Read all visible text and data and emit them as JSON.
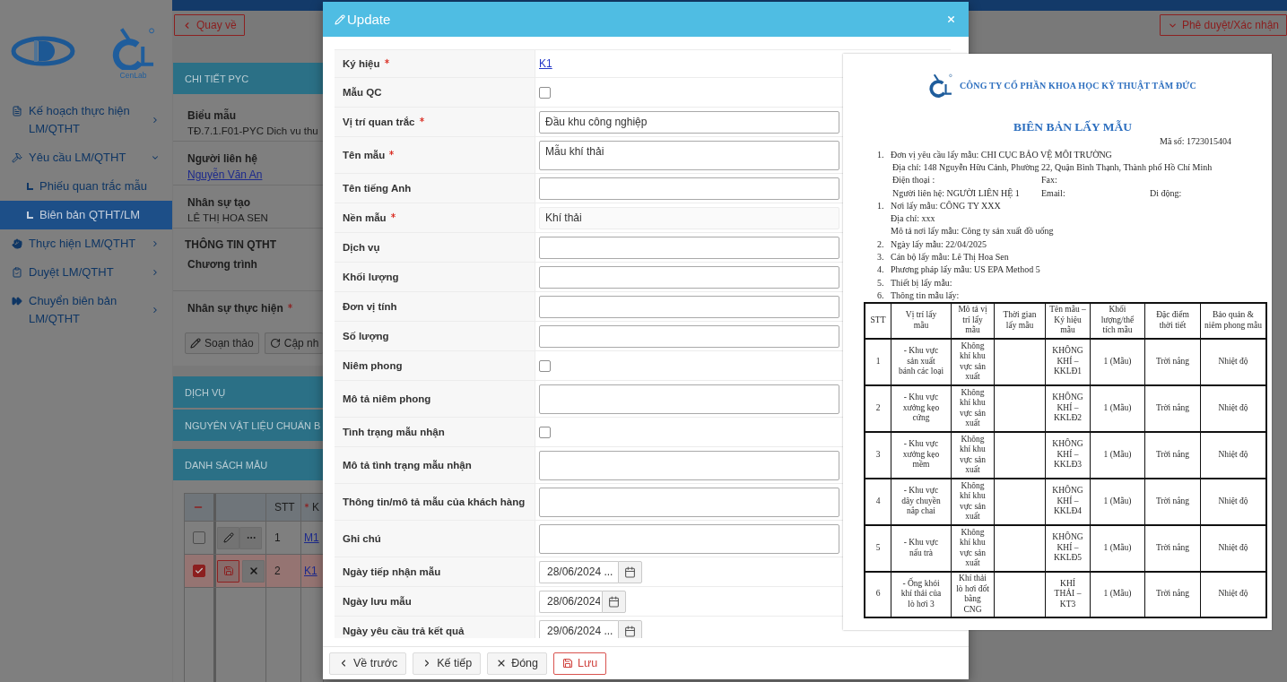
{
  "sidebar": {
    "logo_caption": "CenLab",
    "items": [
      {
        "label": "Kế hoạch thực hiện LM/QTHT",
        "selected": false,
        "expanded": false
      },
      {
        "label": "Yêu cầu LM/QTHT",
        "selected": false,
        "expanded": true,
        "children": [
          {
            "label": "Phiếu quan trắc mẫu",
            "selected": false
          },
          {
            "label": "Biên bản QTHT/LM",
            "selected": true
          }
        ]
      },
      {
        "label": "Thực hiện LM/QTHT",
        "selected": false,
        "expanded": false
      },
      {
        "label": "Duyệt LM/QTHT",
        "selected": false,
        "expanded": false
      },
      {
        "label": "Chuyển biên bản LM/QTHT",
        "selected": false,
        "expanded": false
      }
    ]
  },
  "toolbar": {
    "back_button": "Quay về",
    "approve_button": "Phê duyệt/Xác nhận"
  },
  "detail": {
    "header": "CHI TIẾT PYC",
    "fields": [
      {
        "label": "Biểu mẫu",
        "value": "TĐ.7.1.F01-PYC Dich vu thu",
        "kind": "text"
      },
      {
        "label": "Người liên hệ",
        "value": "Nguyễn Văn An",
        "kind": "link"
      },
      {
        "label": "Nhân sự tạo",
        "value": "LÊ THỊ HOA SEN",
        "kind": "text"
      }
    ],
    "section_title": "THÔNG TIN QTHT",
    "program_label": "Chương trình",
    "staff_label": "Nhân sự thực hiện",
    "staff_required": true,
    "buttons": [
      {
        "label": "Soạn thảo",
        "kind": "edit"
      },
      {
        "label": "Cập nh",
        "kind": "refresh"
      }
    ]
  },
  "sections": [
    "DỊCH VỤ",
    "NGUYÊN VẬT LIỆU CHUẨN B",
    "DANH SÁCH MẪU"
  ],
  "samples_table": {
    "columns": [
      {
        "label": "STT",
        "required": false
      },
      {
        "label": "K",
        "required": true
      }
    ],
    "rows": [
      {
        "checked": false,
        "selected": false,
        "editing": false,
        "stt": "1",
        "code": "M1"
      },
      {
        "checked": true,
        "selected": true,
        "editing": true,
        "stt": "2",
        "code": "K1"
      }
    ]
  },
  "modal": {
    "title": "Update",
    "fields": [
      {
        "kind": "link",
        "label": "Ký hiệu",
        "required": true,
        "value": "K1"
      },
      {
        "kind": "checkbox",
        "label": "Mẫu QC",
        "required": false,
        "checked": false
      },
      {
        "kind": "text",
        "label": "Vị trí quan trắc",
        "required": true,
        "value": "Đầu khu công nghiệp"
      },
      {
        "kind": "textarea",
        "label": "Tên mẫu",
        "required": true,
        "value": "Mẫu khí thải"
      },
      {
        "kind": "text",
        "label": "Tên tiếng Anh",
        "required": false
      },
      {
        "kind": "readonly",
        "label": "Nền mẫu",
        "required": true,
        "value": "Khí thải"
      },
      {
        "kind": "text",
        "label": "Dịch vụ",
        "required": false
      },
      {
        "kind": "text",
        "label": "Khối lượng",
        "required": false
      },
      {
        "kind": "text",
        "label": "Đơn vị tính",
        "required": false
      },
      {
        "kind": "text",
        "label": "Số lượng",
        "required": false
      },
      {
        "kind": "checkbox",
        "label": "Niêm phong",
        "required": false,
        "checked": false
      },
      {
        "kind": "textarea",
        "label": "Mô tả niêm phong",
        "required": false
      },
      {
        "kind": "checkbox",
        "label": "Tình trạng mẫu nhận",
        "required": false,
        "checked": false
      },
      {
        "kind": "textarea",
        "label": "Mô tả tình trạng mẫu nhận",
        "required": false
      },
      {
        "kind": "textarea",
        "label": "Thông tin/mô tả mẫu của khách hàng",
        "required": false
      },
      {
        "kind": "textarea",
        "label": "Ghi chú",
        "required": false
      },
      {
        "kind": "datetime",
        "label": "Ngày tiếp nhận mẫu",
        "required": false,
        "value": "28/06/2024 ..."
      },
      {
        "kind": "date",
        "label": "Ngày lưu mẫu",
        "required": false,
        "value": "28/06/2024"
      },
      {
        "kind": "datetime",
        "label": "Ngày yêu cầu trả kết quả",
        "required": false,
        "value": "29/06/2024 ..."
      }
    ],
    "footer_buttons": [
      {
        "label": "Về trước",
        "kind": "prev"
      },
      {
        "label": "Kế tiếp",
        "kind": "next"
      },
      {
        "label": "Đóng",
        "kind": "close"
      },
      {
        "label": "Lưu",
        "kind": "save"
      }
    ]
  },
  "document": {
    "company": "CÔNG TY CỔ PHẦN KHOA HỌC KỸ THUẬT TÂM ĐỨC",
    "title": "BIÊN BẢN LẤY MẪU",
    "code": "Mã số: 1723015404",
    "items": [
      {
        "number": "1.",
        "text": "Đơn vị yêu cầu lấy mẫu: CHI CỤC BẢO VỆ MÔI TRƯỜNG",
        "details": [
          [
            "Địa chỉ: 148 Nguyễn Hữu Cảnh, Phường 22, Quận Bình Thạnh, Thành phố Hồ Chí Minh"
          ],
          [
            "Điện thoại :",
            "Fax:"
          ],
          [
            "Người liên hệ: NGƯỜI LIÊN HỆ 1",
            "Email:",
            "Di động:"
          ]
        ]
      },
      {
        "number": "1.",
        "text": "Nơi lấy mẫu: CÔNG TY XXX",
        "details": [
          [
            "Địa chỉ: xxx"
          ],
          [
            "Mô tả nơi lấy mẫu: Công ty sản xuất đồ uống"
          ]
        ]
      },
      {
        "number": "2.",
        "text": "Ngày lấy mẫu: 22/04/2025"
      },
      {
        "number": "3.",
        "text": "Cán bộ lấy mẫu: Lê Thị Hoa Sen"
      },
      {
        "number": "4.",
        "text": "Phương pháp lấy mẫu: US EPA Method 5"
      },
      {
        "number": "5.",
        "text": "Thiết bị lấy mẫu:"
      },
      {
        "number": "6.",
        "text": "Thông tin mẫu lấy:"
      }
    ],
    "table": {
      "columns": [
        "STT",
        "Vị trí lấy mẫu",
        "Mô tả vị trí lấy mẫu",
        "Thời gian lấy mẫu",
        "Tên mẫu – Ký hiệu mẫu",
        "Khối lượng/thể tích mẫu",
        "Đặc điểm thời tiết",
        "Bảo quản & niêm phong mẫu"
      ],
      "rows": [
        {
          "stt": "1",
          "location": "- Khu vực sản xuất bánh các loại",
          "location_description": "Không khí khu vực sản xuất",
          "sample": "KHÔNG KHÍ – KKLĐ1",
          "volume": "1 (Mẫu)",
          "weather": "Trời nắng",
          "preservation": "Nhiệt độ"
        },
        {
          "stt": "2",
          "location": "- Khu vực xưởng kẹo cứng",
          "location_description": "Không khí khu vực sản xuất",
          "sample": "KHÔNG KHÍ – KKLĐ2",
          "volume": "1 (Mẫu)",
          "weather": "Trời nắng",
          "preservation": "Nhiệt độ"
        },
        {
          "stt": "3",
          "location": "- Khu vực xưởng kẹo mềm",
          "location_description": "Không khí khu vực sản xuất",
          "sample": "KHÔNG KHÍ – KKLĐ3",
          "volume": "1 (Mẫu)",
          "weather": "Trời nắng",
          "preservation": "Nhiệt độ"
        },
        {
          "stt": "4",
          "location": "- Khu vực dây chuyền nắp chai",
          "location_description": "Không khí khu vực sản xuất",
          "sample": "KHÔNG KHÍ – KKLĐ4",
          "volume": "1 (Mẫu)",
          "weather": "Trời nắng",
          "preservation": "Nhiệt độ"
        },
        {
          "stt": "5",
          "location": "- Khu vực nấu trà",
          "location_description": "Không khí khu vực sản xuất",
          "sample": "KHÔNG KHÍ – KKLĐ5",
          "volume": "1 (Mẫu)",
          "weather": "Trời nắng",
          "preservation": "Nhiệt độ"
        },
        {
          "stt": "6",
          "location": "- Ống khói khí thải của lò hơi 3",
          "location_description": "Khí thải lò hơi đốt bằng CNG",
          "sample": "KHÍ THẢI – KT3",
          "volume": "1 (Mẫu)",
          "weather": "Trời nắng",
          "preservation": "Nhiệt độ"
        }
      ]
    }
  }
}
